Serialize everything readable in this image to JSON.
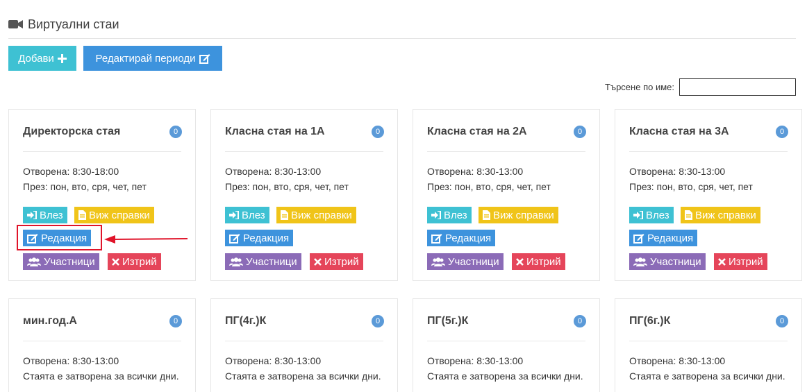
{
  "header": {
    "title": "Виртуални стаи",
    "icon": "video-camera-icon"
  },
  "toolbar": {
    "add_label": "Добави",
    "edit_periods_label": "Редактирай периоди"
  },
  "search": {
    "label": "Търсене по име:",
    "value": ""
  },
  "colors": {
    "teal": "#3ec1d3",
    "blue": "#3d93dd",
    "yellow": "#f0c419",
    "purple": "#8b6bb7",
    "red": "#e5455a",
    "badge": "#5b9ad8",
    "highlight": "#e0142a"
  },
  "button_labels": {
    "enter": "Влез",
    "reports": "Виж справки",
    "edit": "Редакция",
    "members": "Участници",
    "delete": "Изтрий"
  },
  "rooms": [
    {
      "title": "Директорска стая",
      "count": "0",
      "open": "Отворена: 8:30-18:00",
      "days": "През: пон, вто, сря, чет, пет"
    },
    {
      "title": "Класна стая на 1А",
      "count": "0",
      "open": "Отворена: 8:30-13:00",
      "days": "През: пон, вто, сря, чет, пет"
    },
    {
      "title": "Класна стая на 2А",
      "count": "0",
      "open": "Отворена: 8:30-13:00",
      "days": "През: пон, вто, сря, чет, пет"
    },
    {
      "title": "Класна стая на 3А",
      "count": "0",
      "open": "Отворена: 8:30-13:00",
      "days": "През: пон, вто, сря, чет, пет"
    },
    {
      "title": "мин.год.А",
      "count": "0",
      "open": "Отворена: 8:30-13:00",
      "days": "Стаята е затворена за всички дни."
    },
    {
      "title": "ПГ(4г.)К",
      "count": "0",
      "open": "Отворена: 8:30-13:00",
      "days": "Стаята е затворена за всички дни."
    },
    {
      "title": "ПГ(5г.)К",
      "count": "0",
      "open": "Отворена: 8:30-13:00",
      "days": "Стаята е затворена за всички дни."
    },
    {
      "title": "ПГ(6г.)К",
      "count": "0",
      "open": "Отворена: 8:30-13:00",
      "days": "Стаята е затворена за всички дни."
    }
  ]
}
